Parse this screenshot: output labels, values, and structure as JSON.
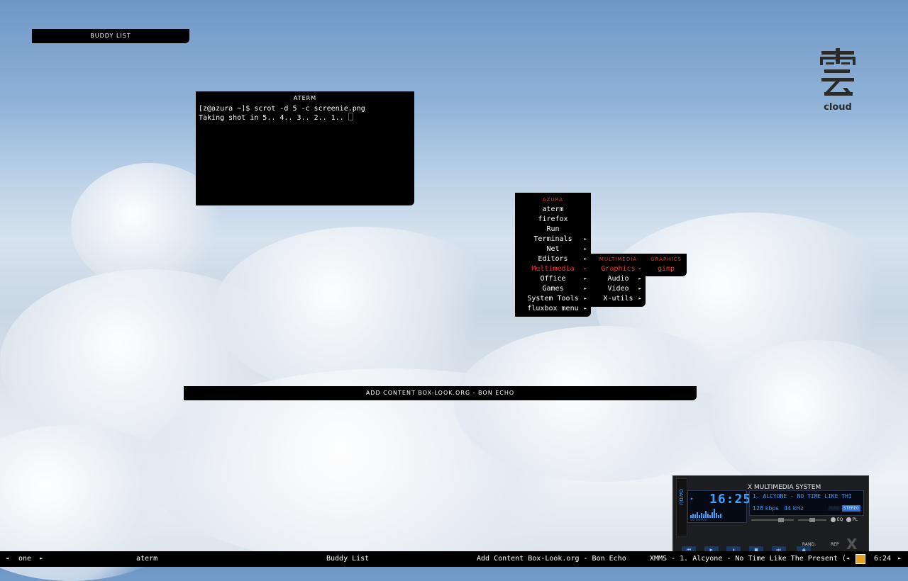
{
  "windows": {
    "buddy_list_title": "BUDDY LIST",
    "aterm_title": "ATERM",
    "browser_title": "ADD CONTENT BOX-LOOK.ORG - BON ECHO"
  },
  "terminal": {
    "line1": "[z@azura ~]$ scrot -d 5 -c screenie.png",
    "line2": "Taking shot in 5.. 4.. 3.. 2.. 1.. "
  },
  "root_menu": {
    "title": "AZURA",
    "items": [
      "aterm",
      "firefox",
      "Run",
      "Terminals",
      "Net",
      "Editors",
      "Multimedia",
      "Office",
      "Games",
      "System Tools",
      "fluxbox menu"
    ]
  },
  "multimedia_menu": {
    "title": "MULTIMEDIA",
    "items": [
      "Graphics",
      "Audio",
      "Video",
      "X-utils"
    ]
  },
  "graphics_menu": {
    "title": "GRAPHICS",
    "items": [
      "gimp"
    ]
  },
  "desktop_logo": {
    "text": "cloud"
  },
  "xmms": {
    "title": "X MULTIMEDIA SYSTEM",
    "time": "16:25",
    "song": "1. ALCYONE - NO TIME LIKE THI",
    "kbps": "128 kbps",
    "khz": "44 kHz",
    "mono": "MONO",
    "stereo": "STEREO",
    "eq": "EQ",
    "pl": "PL",
    "rand": "RAND.",
    "rep": "REP",
    "vis_label": "VIS DISPLAY",
    "side_label": "OAIDU"
  },
  "taskbar": {
    "workspace": "one",
    "items": [
      "aterm",
      "Buddy List",
      "Add Content Box-Look.org - Bon Echo",
      "XMMS - 1. Alcyone - No Time Like The Present ("
    ],
    "clock": "6:24"
  },
  "colors": {
    "accent": "#e33333",
    "panel": "#000000",
    "lcd": "#3aa0ff"
  }
}
